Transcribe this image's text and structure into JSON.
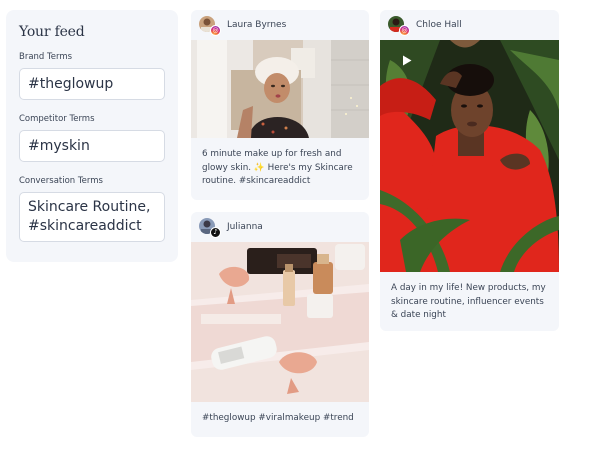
{
  "feed_panel": {
    "title": "Your feed",
    "brand_terms_label": "Brand Terms",
    "brand_terms_value": "#theglowup",
    "competitor_terms_label": "Competitor Terms",
    "competitor_terms_value": "#myskin",
    "conversation_terms_label": "Conversation Terms",
    "conversation_terms_line1": "Skincare Routine,",
    "conversation_terms_line2": "#skincareaddict"
  },
  "posts": [
    {
      "username": "Laura Byrnes",
      "network_icon": "instagram-icon",
      "caption": "6 minute make up for fresh and glowy skin. ✨ Here's my Skincare routine. #skincareaddict"
    },
    {
      "username": "Julianna",
      "network_icon": "tiktok-icon",
      "caption": "#theglowup #viralmakeup #trend"
    },
    {
      "username": "Chloe Hall",
      "network_icon": "instagram-icon",
      "media_type": "video",
      "caption": "A day in my life! New products, my skincare routine, influencer events & date night"
    }
  ],
  "colors": {
    "panel_bg": "#f4f6fa",
    "input_border": "#d6dbe4",
    "text": "#2f3a4b",
    "sweater_red": "#e0261c"
  }
}
